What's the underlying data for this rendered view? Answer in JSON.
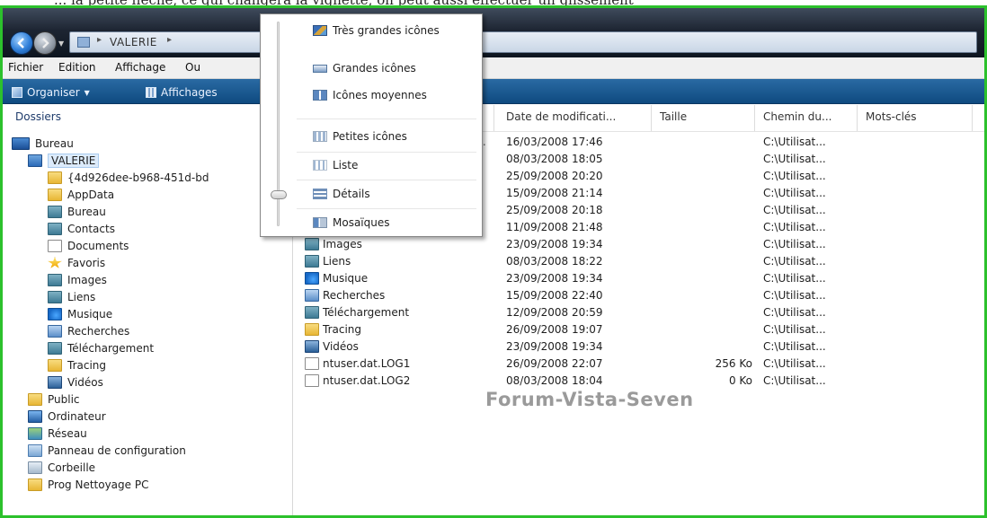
{
  "top_caption": "... la petite flèche, ce qui changera la vignette, on peut aussi effectuer un glissement",
  "address": {
    "path": "VALERIE"
  },
  "menubar": [
    "Fichier",
    "Edition",
    "Affichage",
    "Ou"
  ],
  "toolbar": {
    "organiser": "Organiser",
    "affichages": "Affichages"
  },
  "left_pane": {
    "header": "Dossiers",
    "items": [
      {
        "label": "Bureau",
        "icon": "desktop-icon"
      },
      {
        "label": "VALERIE",
        "icon": "user-folder-icon"
      },
      {
        "label": "{4d926dee-b968-451d-bd",
        "icon": "folder-icon"
      },
      {
        "label": "AppData",
        "icon": "folder-icon"
      },
      {
        "label": "Bureau",
        "icon": "desktop-folder-icon"
      },
      {
        "label": "Contacts",
        "icon": "contacts-icon"
      },
      {
        "label": "Documents",
        "icon": "documents-icon"
      },
      {
        "label": "Favoris",
        "icon": "star-icon"
      },
      {
        "label": "Images",
        "icon": "images-icon"
      },
      {
        "label": "Liens",
        "icon": "links-icon"
      },
      {
        "label": "Musique",
        "icon": "music-icon"
      },
      {
        "label": "Recherches",
        "icon": "search-folder-icon"
      },
      {
        "label": "Téléchargement",
        "icon": "downloads-icon"
      },
      {
        "label": "Tracing",
        "icon": "folder-icon"
      },
      {
        "label": "Vidéos",
        "icon": "videos-icon"
      },
      {
        "label": "Public",
        "icon": "folder-icon"
      },
      {
        "label": "Ordinateur",
        "icon": "computer-icon"
      },
      {
        "label": "Réseau",
        "icon": "network-icon"
      },
      {
        "label": "Panneau de configuration",
        "icon": "control-panel-icon"
      },
      {
        "label": "Corbeille",
        "icon": "recycle-bin-icon"
      },
      {
        "label": "Prog Nettoyage PC",
        "icon": "folder-icon"
      }
    ]
  },
  "columns": [
    "Date de modificati...",
    "Taille",
    "Chemin du...",
    "Mots-clés"
  ],
  "rows": [
    {
      "name": "",
      "date": "16/03/2008 17:46",
      "size": "",
      "path": "C:\\Utilisat..."
    },
    {
      "name": "",
      "date": "08/03/2008 18:05",
      "size": "",
      "path": "C:\\Utilisat..."
    },
    {
      "name": "",
      "date": "25/09/2008 20:20",
      "size": "",
      "path": "C:\\Utilisat..."
    },
    {
      "name": "",
      "date": "15/09/2008 21:14",
      "size": "",
      "path": "C:\\Utilisat..."
    },
    {
      "name": "",
      "date": "25/09/2008 20:18",
      "size": "",
      "path": "C:\\Utilisat..."
    },
    {
      "name": "",
      "date": "11/09/2008 21:48",
      "size": "",
      "path": "C:\\Utilisat..."
    },
    {
      "name": "Images",
      "date": "23/09/2008 19:34",
      "size": "",
      "path": "C:\\Utilisat..."
    },
    {
      "name": "Liens",
      "date": "08/03/2008 18:22",
      "size": "",
      "path": "C:\\Utilisat..."
    },
    {
      "name": "Musique",
      "date": "23/09/2008 19:34",
      "size": "",
      "path": "C:\\Utilisat..."
    },
    {
      "name": "Recherches",
      "date": "15/09/2008 22:40",
      "size": "",
      "path": "C:\\Utilisat..."
    },
    {
      "name": "Téléchargement",
      "date": "12/09/2008 20:59",
      "size": "",
      "path": "C:\\Utilisat..."
    },
    {
      "name": "Tracing",
      "date": "26/09/2008 19:07",
      "size": "",
      "path": "C:\\Utilisat..."
    },
    {
      "name": "Vidéos",
      "date": "23/09/2008 19:34",
      "size": "",
      "path": "C:\\Utilisat..."
    },
    {
      "name": "ntuser.dat.LOG1",
      "date": "26/09/2008 22:07",
      "size": "256 Ko",
      "path": "C:\\Utilisat..."
    },
    {
      "name": "ntuser.dat.LOG2",
      "date": "08/03/2008 18:04",
      "size": "0 Ko",
      "path": "C:\\Utilisat..."
    }
  ],
  "watermark": "Forum-Vista-Seven",
  "views_menu": {
    "items": [
      "Très grandes icônes",
      "Grandes icônes",
      "Icônes moyennes",
      "Petites icônes",
      "Liste",
      "Détails",
      "Mosaïques"
    ],
    "selected": "Détails"
  }
}
